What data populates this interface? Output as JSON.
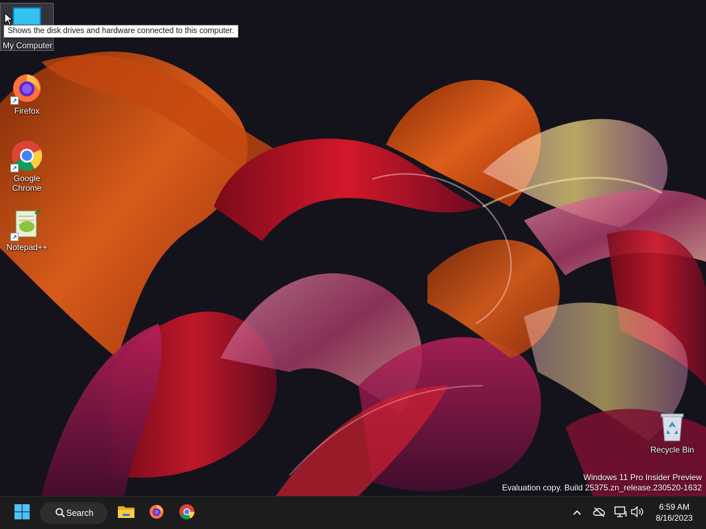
{
  "desktop": {
    "icons": [
      {
        "label": "My Computer",
        "icon": "monitor-icon"
      },
      {
        "label": "Firefox",
        "icon": "firefox-icon"
      },
      {
        "label": "Google Chrome",
        "icon": "chrome-icon"
      },
      {
        "label": "Notepad++",
        "icon": "notepadpp-icon"
      },
      {
        "label": "Recycle Bin",
        "icon": "recycle-bin-icon"
      }
    ],
    "tooltip": "Shows the disk drives and hardware connected to this computer.",
    "watermark": {
      "line1": "Windows 11 Pro Insider Preview",
      "line2": "Evaluation copy. Build 25375.zn_release.230520-1632"
    }
  },
  "taskbar": {
    "start_icon": "windows-logo-icon",
    "search_label": "Search",
    "pinned": [
      {
        "name": "File Explorer",
        "icon": "folder-icon"
      },
      {
        "name": "Firefox",
        "icon": "firefox-icon"
      },
      {
        "name": "Google Chrome",
        "icon": "chrome-icon"
      }
    ],
    "tray": {
      "icons": [
        "chevron-up-icon",
        "cloud-offline-icon",
        "network-icon",
        "volume-icon"
      ],
      "time": "6:59 AM",
      "date": "8/16/2023"
    }
  },
  "colors": {
    "taskbar_bg": "#1c1c1c",
    "search_bg": "#2d2d2d",
    "wallpaper_bg": "#14131c",
    "accent_orange": "#e8621a",
    "accent_red": "#c0121e"
  }
}
